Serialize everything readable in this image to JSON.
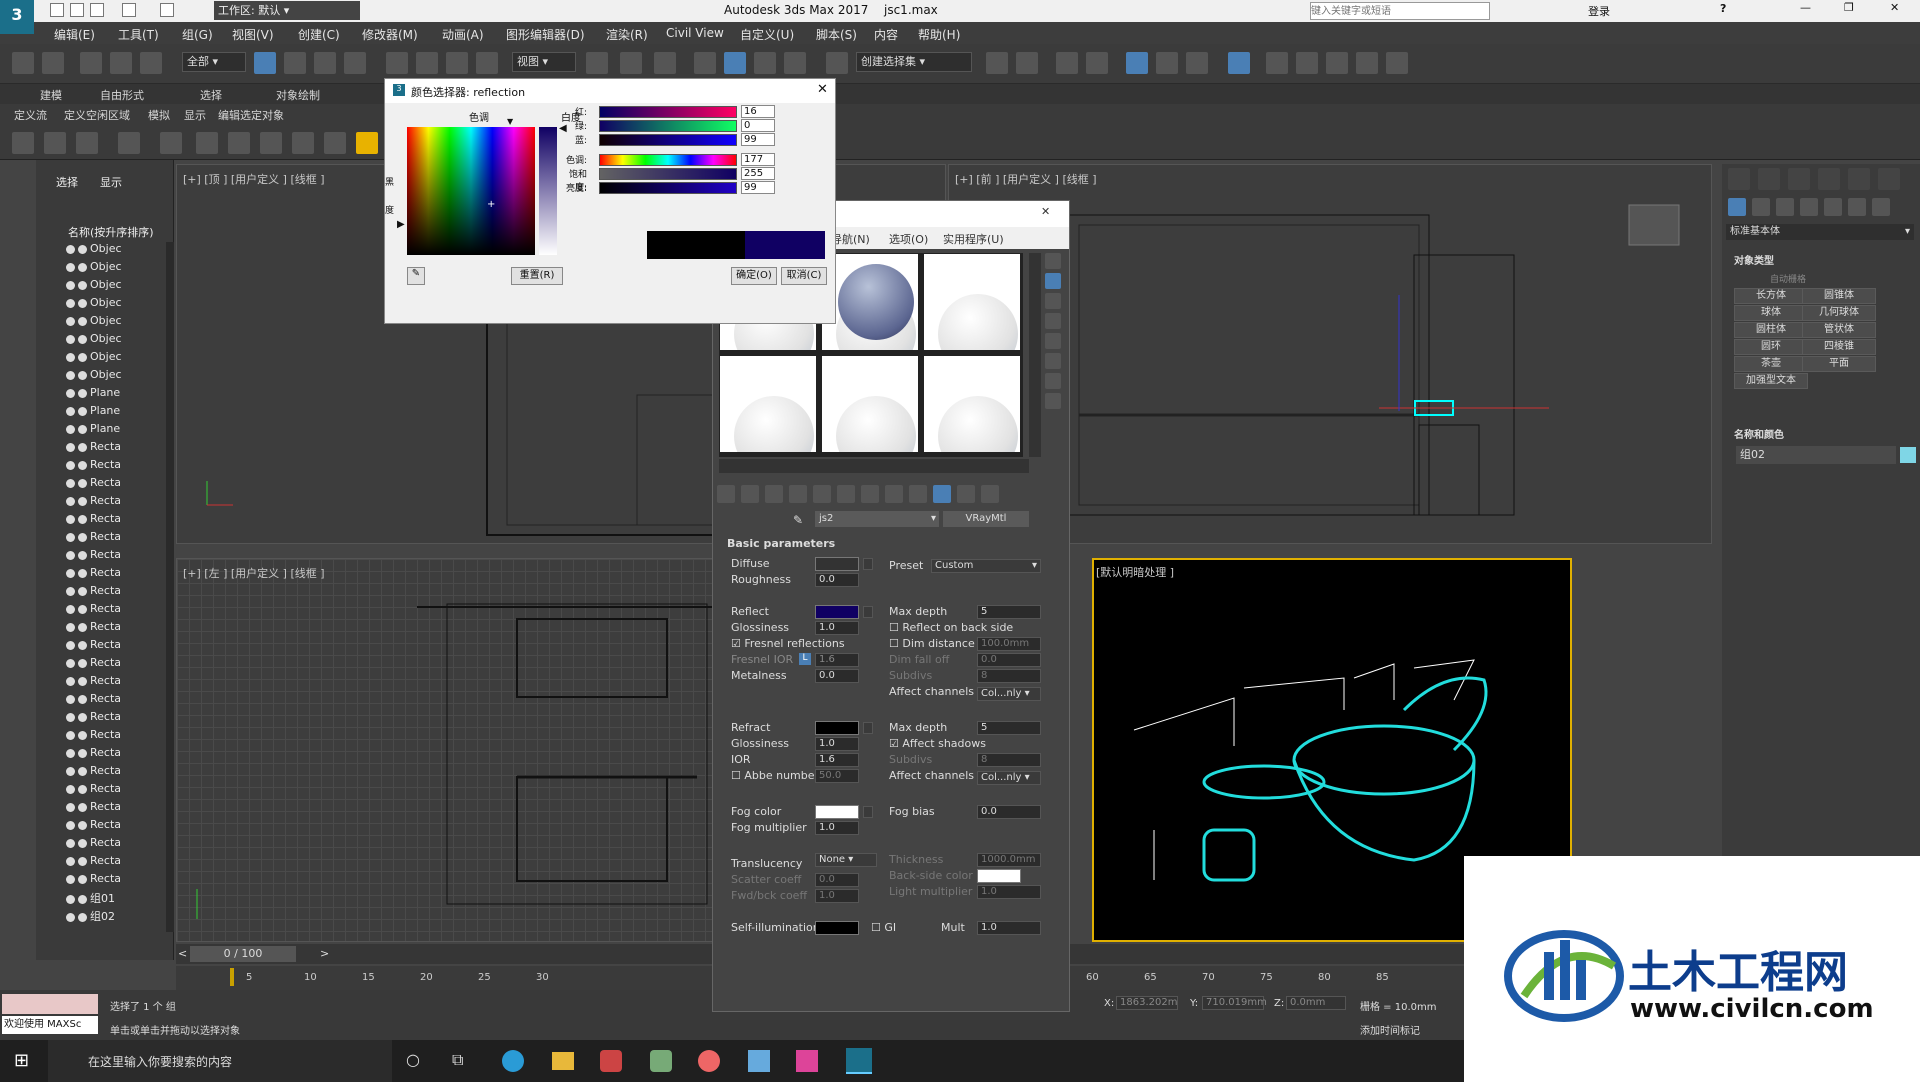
{
  "title_bar": {
    "workspace": "工作区: 默认",
    "app": "Autodesk 3ds Max 2017",
    "file": "jsc1.max",
    "search_placeholder": "键入关键字或短语",
    "login": "登录"
  },
  "menu": [
    "编辑(E)",
    "工具(T)",
    "组(G)",
    "视图(V)",
    "创建(C)",
    "修改器(M)",
    "动画(A)",
    "图形编辑器(D)",
    "渲染(R)",
    "Civil View",
    "自定义(U)",
    "脚本(S)",
    "内容",
    "帮助(H)"
  ],
  "toolbar": {
    "filter": "全部",
    "view": "视图",
    "selection_set": "创建选择集"
  },
  "ribbon": {
    "tabs": [
      "建模",
      "自由形式",
      "选择",
      "对象绘制"
    ],
    "sub": [
      "定义流",
      "定义空闲区域",
      "模拟",
      "显示",
      "编辑选定对象"
    ]
  },
  "scene": {
    "tab_select": "选择",
    "tab_display": "显示",
    "header": "名称(按升序排序)",
    "items": [
      "Objec",
      "Objec",
      "Objec",
      "Objec",
      "Objec",
      "Objec",
      "Objec",
      "Objec",
      "Plane",
      "Plane",
      "Plane",
      "Recta",
      "Recta",
      "Recta",
      "Recta",
      "Recta",
      "Recta",
      "Recta",
      "Recta",
      "Recta",
      "Recta",
      "Recta",
      "Recta",
      "Recta",
      "Recta",
      "Recta",
      "Recta",
      "Recta",
      "Recta",
      "Recta",
      "Recta",
      "Recta",
      "Recta",
      "Recta",
      "Recta",
      "Recta",
      "组01",
      "组02"
    ]
  },
  "viewports": {
    "top": "[+] [顶 ] [用户定义 ] [线框 ]",
    "front": "[+] [前 ] [用户定义 ] [线框 ]",
    "left": "[+] [左 ] [用户定义 ] [线框 ]",
    "persp": "[默认明暗处理 ]"
  },
  "command_panel": {
    "category": "标准基本体",
    "rollout_types": "对象类型",
    "autogrid": "自动栅格",
    "buttons": [
      "长方体",
      "圆锥体",
      "球体",
      "几何球体",
      "圆柱体",
      "管状体",
      "圆环",
      "四棱锥",
      "茶壶",
      "平面",
      "加强型文本"
    ],
    "rollout_name": "名称和颜色",
    "object_name": "组02"
  },
  "color_picker": {
    "title": "颜色选择器: reflection",
    "hue_label": "色调",
    "white_label": "白度",
    "black_label": "黑",
    "degree_label": "度",
    "rows": [
      {
        "label": "红:",
        "value": "16"
      },
      {
        "label": "绿:",
        "value": "0"
      },
      {
        "label": "蓝:",
        "value": "99"
      },
      {
        "label": "色调:",
        "value": "177"
      },
      {
        "label": "饱和度:",
        "value": "255"
      },
      {
        "label": "亮度:",
        "value": "99"
      }
    ],
    "reset": "重置(R)",
    "ok": "确定(O)",
    "cancel": "取消(C)",
    "color": "#100063"
  },
  "material_editor": {
    "menus": [
      "导航(N)",
      "选项(O)",
      "实用程序(U)"
    ],
    "material_name": "js2",
    "material_type": "VRayMtl",
    "rollout": "Basic parameters",
    "diffuse": "Diffuse",
    "roughness": "Roughness",
    "roughness_val": "0.0",
    "preset": "Preset",
    "preset_val": "Custom",
    "reflect": "Reflect",
    "glossiness": "Glossiness",
    "gloss_val": "1.0",
    "fresnel": "Fresnel reflections",
    "fresnel_ior": "Fresnel IOR",
    "fresnel_ior_val": "1.6",
    "fresnel_l": "L",
    "metalness": "Metalness",
    "metal_val": "0.0",
    "max_depth": "Max depth",
    "max_depth_val": "5",
    "reflect_back": "Reflect on back side",
    "dim_distance": "Dim distance",
    "dim_val": "100.0mm",
    "dim_falloff": "Dim fall off",
    "dim_falloff_val": "0.0",
    "subdivs": "Subdivs",
    "subdivs_val": "8",
    "affect_channels": "Affect channels",
    "affect_val": "Col...nly",
    "refract": "Refract",
    "r_gloss_val": "1.0",
    "ior": "IOR",
    "ior_val": "1.6",
    "abbe": "Abbe number",
    "abbe_val": "50.0",
    "r_max_depth_val": "5",
    "affect_shadows": "Affect shadows",
    "fog_color": "Fog color",
    "fog_mult": "Fog multiplier",
    "fog_mult_val": "1.0",
    "fog_bias": "Fog bias",
    "fog_bias_val": "0.0",
    "translucency": "Translucency",
    "trans_val": "None",
    "scatter": "Scatter coeff",
    "scatter_val": "0.0",
    "fwd": "Fwd/bck coeff",
    "fwd_val": "1.0",
    "thickness": "Thickness",
    "thick_val": "1000.0mm",
    "backside": "Back-side color",
    "light_mult": "Light multiplier",
    "light_val": "1.0",
    "self_illum": "Self-illumination",
    "mult": "Mult",
    "mult_val": "1.0",
    "gi": "GI"
  },
  "timeline": {
    "frame": "0 / 100",
    "ticks": [
      "5",
      "10",
      "15",
      "20",
      "25",
      "30",
      "60",
      "65",
      "70",
      "75",
      "80",
      "85"
    ]
  },
  "status": {
    "selected": "选择了 1 个 组",
    "prompt": "单击或单击并拖动以选择对象",
    "welcome": "欢迎使用 MAXSc",
    "x_label": "X:",
    "x": "1863.202m",
    "y_label": "Y:",
    "y": "710.019mm",
    "z_label": "Z:",
    "z": "0.0mm",
    "grid": "栅格 = 10.0mm",
    "time_tag": "添加时间标记"
  },
  "taskbar": {
    "search": "在这里输入你要搜索的内容"
  },
  "watermark": {
    "title": "土木工程网",
    "url": "www.civilcn.com"
  }
}
